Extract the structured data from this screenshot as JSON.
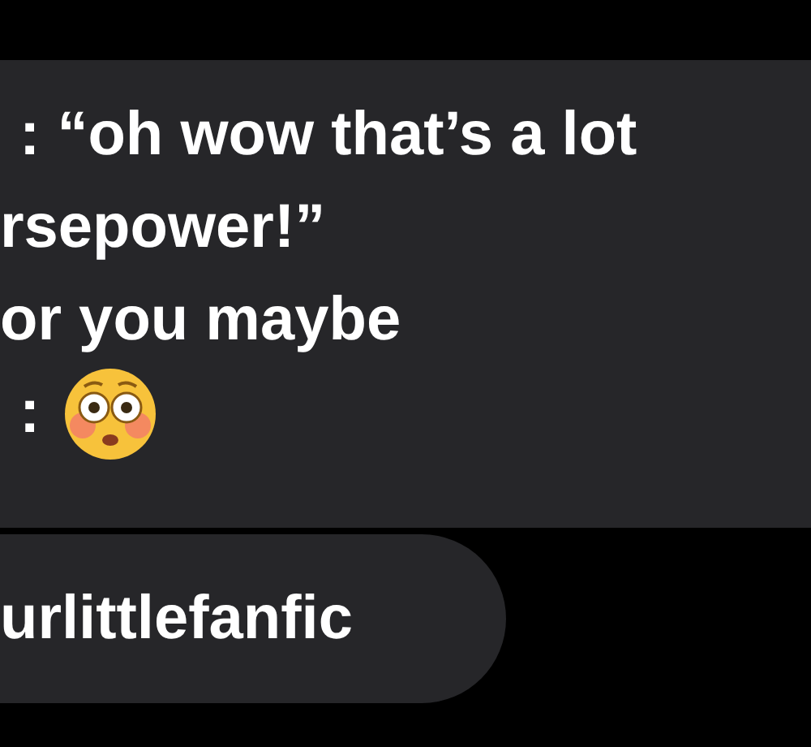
{
  "message_bubble": {
    "lines": [
      {
        "kind": "text",
        "text": ": “oh wow that’s a lot"
      },
      {
        "kind": "text",
        "text": "rsepower!”"
      },
      {
        "kind": "text",
        "text": "or you maybe"
      },
      {
        "kind": "emoji",
        "text": ":"
      }
    ]
  },
  "reply_bubble": {
    "text": "urlittlefanfic"
  }
}
